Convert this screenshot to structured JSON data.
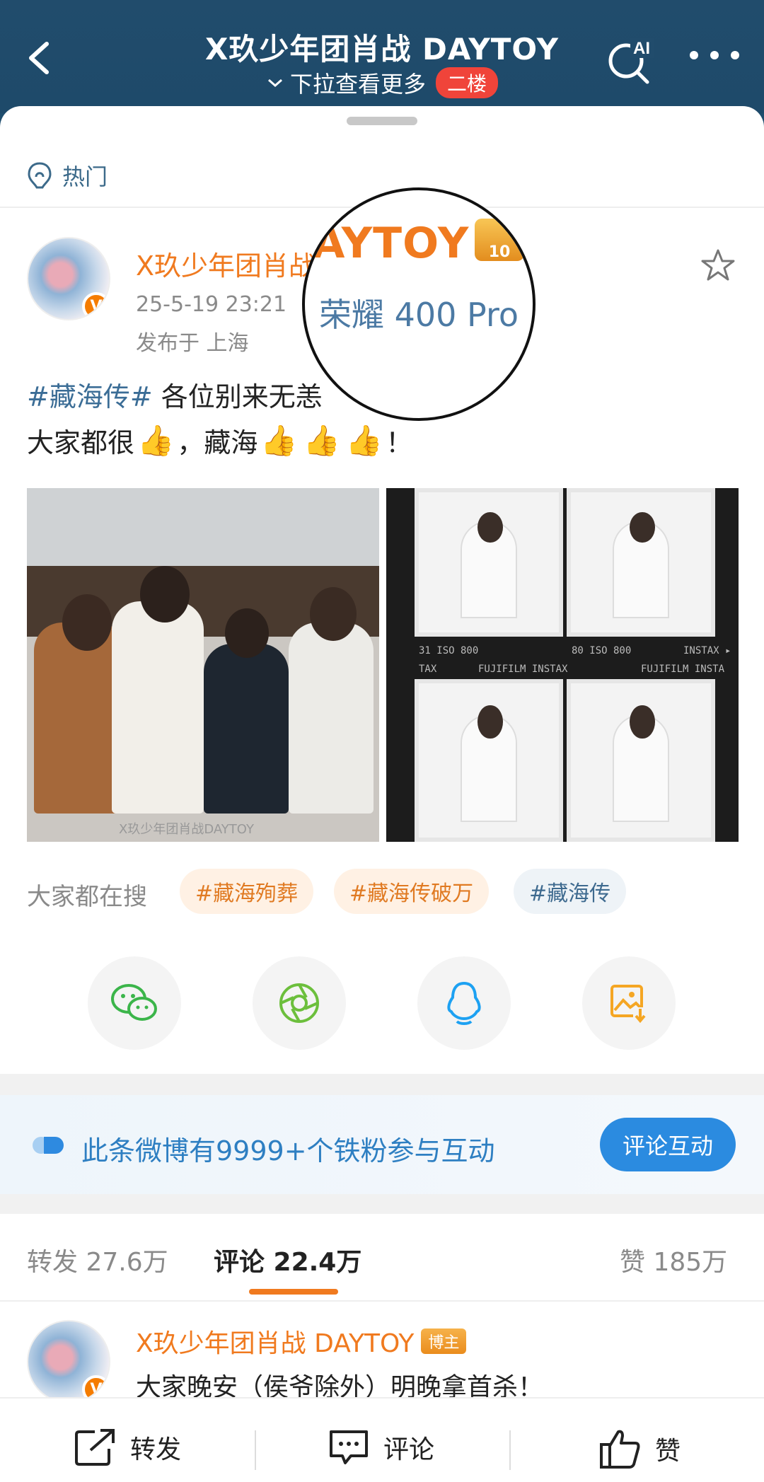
{
  "header": {
    "title": "X玖少年团肖战 DAYTOY",
    "subtitle": "下拉查看更多",
    "floor_badge": "二楼",
    "ai_label": "AI"
  },
  "section": {
    "hot_label": "热门"
  },
  "post": {
    "author": "X玖少年团肖战 DAYTOY",
    "timestamp": "25-5-19 23:21",
    "location": "发布于 上海",
    "hashtag": "#藏海传#",
    "text_line1_rest": " 各位别来无恙",
    "text_line2_start": "大家都很",
    "text_line2_mid": "，藏海",
    "text_line2_end": "！",
    "thumbs_emoji": "👍",
    "photo_watermark": "X玖少年团肖战DAYTOY",
    "film_labels": [
      "31 ISO 800",
      "80 ISO 800",
      "INSTAX ▸",
      "FUJIFILM INSTAX",
      "FUJIFILM INSTA",
      "TAX"
    ]
  },
  "magnifier": {
    "name_fragment": "AYTOY",
    "device": "荣耀 400 Pro",
    "badge": "10"
  },
  "search": {
    "label": "大家都在搜",
    "chips": [
      "#藏海殉葬",
      "#藏海传破万",
      "#藏海传"
    ]
  },
  "fan_banner": {
    "text": "此条微博有9999+个铁粉参与互动",
    "button": "评论互动"
  },
  "tabs": {
    "repost": "转发 27.6万",
    "comment": "评论 22.4万",
    "like": "赞 185万"
  },
  "comment": {
    "author": "X玖少年团肖战 DAYTOY",
    "badge": "博主",
    "text": "大家晚安（侯爷除外）明晚拿首杀！"
  },
  "actions": {
    "repost": "转发",
    "comment": "评论",
    "like": "赞"
  },
  "colors": {
    "header_bg": "#214c6c",
    "accent_orange": "#f07a1f",
    "link_blue": "#3b6d96",
    "fan_blue": "#2b8be0",
    "badge_red": "#f0443a"
  }
}
